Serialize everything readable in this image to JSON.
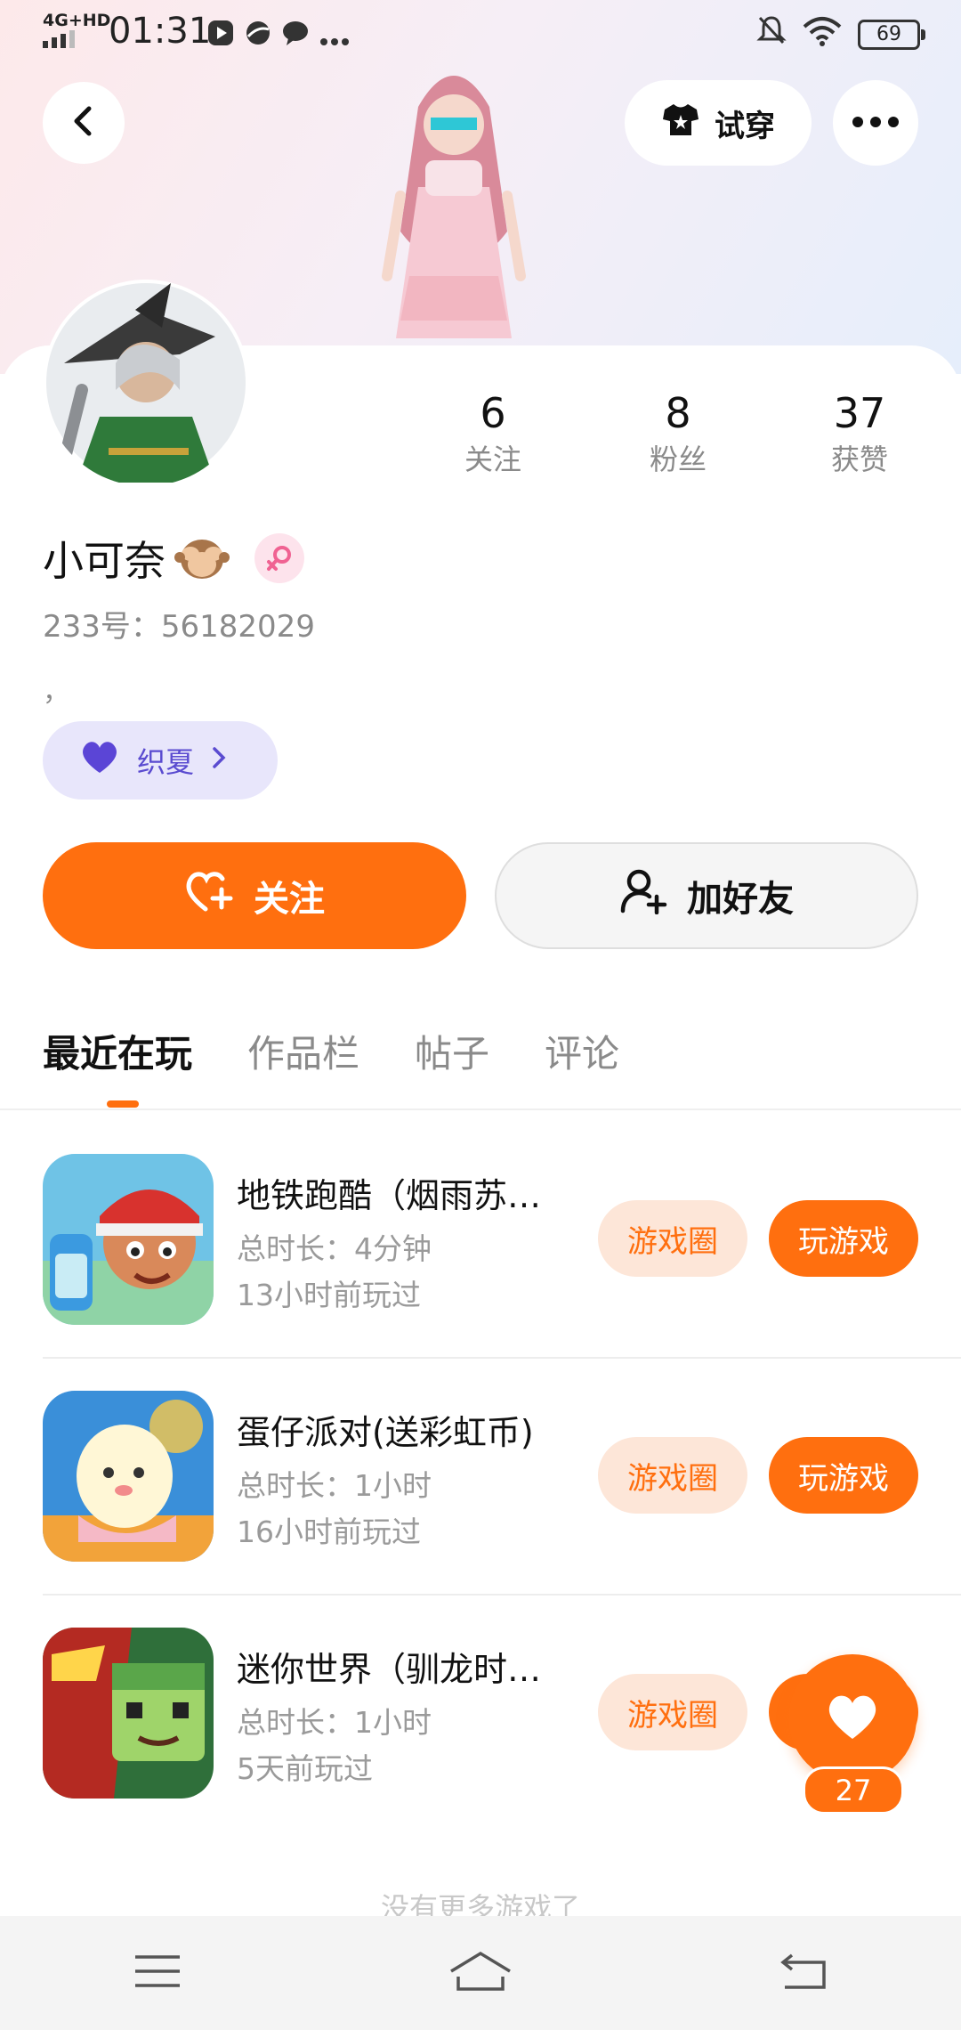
{
  "status": {
    "network": "4G+HD",
    "time": "01:31",
    "battery": "69"
  },
  "header": {
    "try_on_label": "试穿",
    "icons": [
      "back-icon",
      "shirt-icon",
      "more-icon"
    ]
  },
  "profile": {
    "name": "小可奈",
    "uid": "233号：56182029",
    "bio": "，",
    "tag_label": "织夏",
    "stats": [
      {
        "value": "6",
        "label": "关注"
      },
      {
        "value": "8",
        "label": "粉丝"
      },
      {
        "value": "37",
        "label": "获赞"
      }
    ]
  },
  "actions": {
    "follow_label": "关注",
    "add_friend_label": "加好友"
  },
  "tabs": [
    {
      "label": "最近在玩",
      "active": true
    },
    {
      "label": "作品栏",
      "active": false
    },
    {
      "label": "帖子",
      "active": false
    },
    {
      "label": "评论",
      "active": false
    }
  ],
  "games": [
    {
      "title": "地铁跑酷（烟雨苏…",
      "duration": "总时长：4分钟",
      "last_played": "13小时前玩过",
      "circle_label": "游戏圈",
      "play_label": "玩游戏"
    },
    {
      "title": "蛋仔派对(送彩虹币)",
      "duration": "总时长：1小时",
      "last_played": "16小时前玩过",
      "circle_label": "游戏圈",
      "play_label": "玩游戏"
    },
    {
      "title": "迷你世界（驯龙时…",
      "duration": "总时长：1小时",
      "last_played": "5天前玩过",
      "circle_label": "游戏圈",
      "play_label": "玩游戏"
    }
  ],
  "fab": {
    "count": "27"
  },
  "footer_note": "没有更多游戏了",
  "colors": {
    "accent": "#ff6f0f",
    "accent_light": "#fde6d8",
    "tag_bg": "#e8e6fb"
  }
}
